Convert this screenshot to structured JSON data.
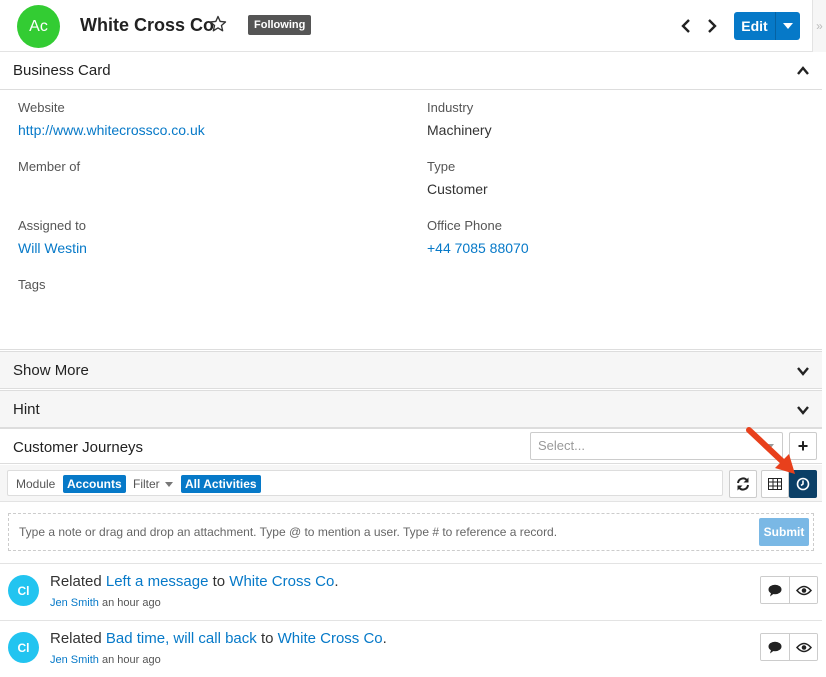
{
  "header": {
    "avatar_initials": "Ac",
    "record_name": "White Cross Co",
    "following_badge": "Following",
    "edit_label": "Edit",
    "sidebar_toggle_glyph": "»"
  },
  "business_card": {
    "title": "Business Card",
    "fields": {
      "website_label": "Website",
      "website_value": "http://www.whitecrossco.co.uk",
      "industry_label": "Industry",
      "industry_value": "Machinery",
      "member_of_label": "Member of",
      "type_label": "Type",
      "type_value": "Customer",
      "assigned_to_label": "Assigned to",
      "assigned_to_value": "Will Westin",
      "office_phone_label": "Office Phone",
      "office_phone_value": "+44 7085 88070",
      "tags_label": "Tags"
    }
  },
  "panels": {
    "show_more": "Show More",
    "hint": "Hint",
    "customer_journeys": "Customer Journeys",
    "journeys_select_placeholder": "Select...",
    "add_glyph": "+"
  },
  "activity_toolbar": {
    "module_label": "Module",
    "module_value": "Accounts",
    "filter_label": "Filter",
    "filter_value": "All Activities"
  },
  "composer": {
    "placeholder": "Type a note or drag and drop an attachment. Type @ to mention a user. Type # to reference a record.",
    "submit_label": "Submit"
  },
  "feed": [
    {
      "avatar": "Cl",
      "prefix": "Related",
      "subject": "Left a message",
      "to_word": "to",
      "target": "White Cross Co",
      "user": "Jen Smith",
      "time": "an hour ago"
    },
    {
      "avatar": "Cl",
      "prefix": "Related",
      "subject": "Bad time, will call back",
      "to_word": "to",
      "target": "White Cross Co",
      "user": "Jen Smith",
      "time": "an hour ago"
    }
  ],
  "colors": {
    "accent": "#0679c8",
    "avatar_green": "#33cc33",
    "feed_avatar": "#22c4f0",
    "annotation_arrow": "#e8401c"
  }
}
